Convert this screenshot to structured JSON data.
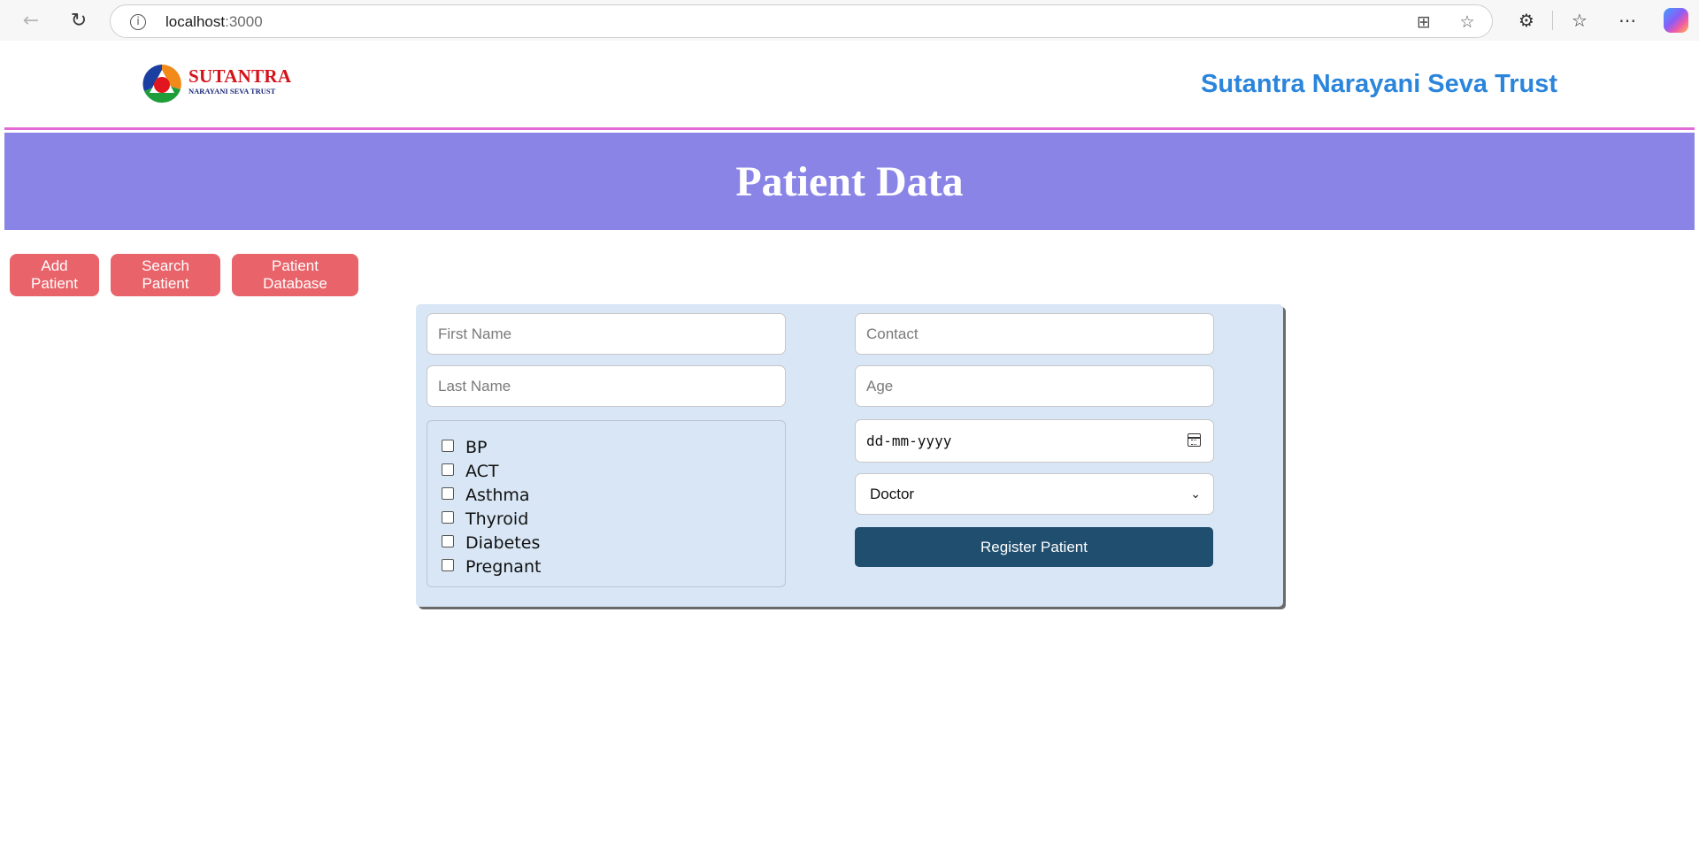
{
  "browser": {
    "url_host": "localhost",
    "url_port": ":3000",
    "icons": [
      "back-arrow-icon",
      "refresh-icon",
      "info-icon",
      "split-screen-icon",
      "favorite-star-icon",
      "extensions-icon",
      "favorites-icon",
      "more-icon",
      "copilot-icon"
    ]
  },
  "header": {
    "logo_main": "SUTANTRA",
    "logo_sub": "NARAYANI SEVA TRUST",
    "trust_name": "Sutantra Narayani Seva Trust"
  },
  "banner": {
    "title": "Patient Data"
  },
  "tabs": [
    {
      "label": "Add Patient"
    },
    {
      "label": "Search Patient"
    },
    {
      "label": "Patient Database"
    }
  ],
  "form": {
    "first_name_placeholder": "First Name",
    "last_name_placeholder": "Last Name",
    "contact_placeholder": "Contact",
    "age_placeholder": "Age",
    "date_placeholder": "dd-mm-yyyy",
    "doctor_selected": "Doctor",
    "conditions": [
      "BP",
      "ACT",
      "Asthma",
      "Thyroid",
      "Diabetes",
      "Pregnant"
    ],
    "register_label": "Register Patient"
  },
  "colors": {
    "banner_bg": "#8a84e6",
    "tab_bg": "#e8636a",
    "card_bg": "#d8e6f5",
    "register_bg": "#1f4e6e",
    "trust_name": "#2b85db",
    "header_border": "#e26ad6"
  }
}
